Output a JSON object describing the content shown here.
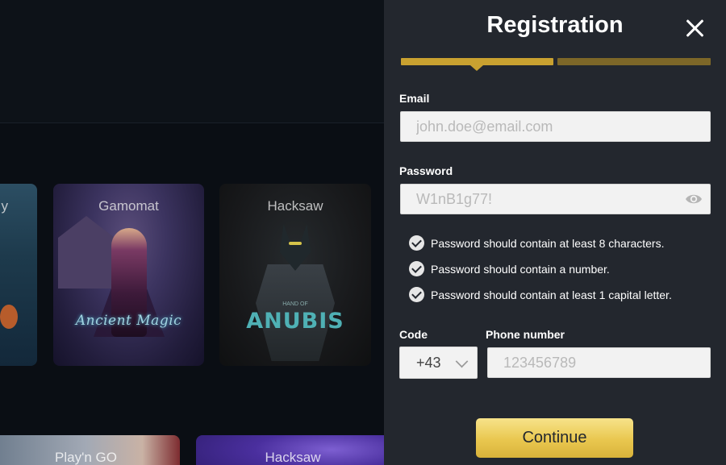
{
  "lobby": {
    "tiles": [
      {
        "provider": "Gamomat",
        "game_logo": "Ancient Magic"
      },
      {
        "provider": "Hacksaw",
        "game_logo": "ANUBIS",
        "game_logo_small": "HAND OF"
      },
      {
        "provider": "Play'n GO"
      },
      {
        "provider": "Hacksaw"
      }
    ],
    "partial_tile_label": "y"
  },
  "registration": {
    "title": "Registration",
    "steps": {
      "total": 2,
      "current": 1
    },
    "email": {
      "label": "Email",
      "placeholder": "john.doe@email.com",
      "value": ""
    },
    "password": {
      "label": "Password",
      "placeholder": "W1nB1g77!",
      "value": ""
    },
    "password_rules": [
      {
        "text": "Password should contain at least 8 characters.",
        "satisfied": true
      },
      {
        "text": "Password should contain a number.",
        "satisfied": true
      },
      {
        "text": "Password should contain at least 1 capital letter.",
        "satisfied": true
      }
    ],
    "code": {
      "label": "Code",
      "value": "+43"
    },
    "phone": {
      "label": "Phone number",
      "placeholder": "123456789",
      "value": ""
    },
    "continue_label": "Continue"
  },
  "icons": {
    "close": "close-icon",
    "eye": "eye-icon",
    "check": "check-circle-icon",
    "chevron": "chevron-down-icon"
  },
  "colors": {
    "panel_bg": "#23272e",
    "step_active": "#c9a130",
    "step_inactive": "#7d6728",
    "button_gradient_top": "#f7e38a",
    "button_gradient_bottom": "#d9b23a"
  }
}
